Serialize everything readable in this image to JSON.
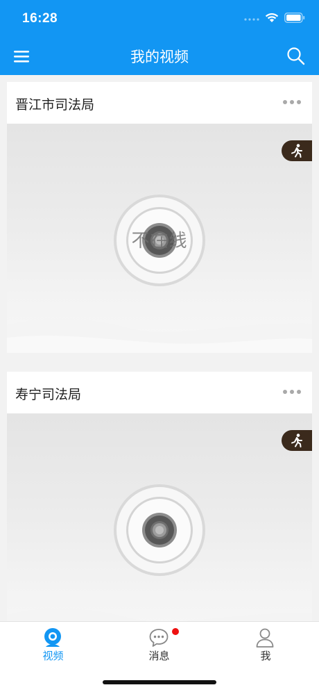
{
  "status_bar": {
    "time": "16:28"
  },
  "nav": {
    "title": "我的视频"
  },
  "cards": [
    {
      "title": "晋江市司法局",
      "status_overlay": "不在线"
    },
    {
      "title": "寿宁司法局"
    }
  ],
  "tabs": [
    {
      "label": "视频",
      "icon": "camera-icon",
      "active": true
    },
    {
      "label": "消息",
      "icon": "chat-bubble-icon",
      "active": false,
      "has_unread_dot": true
    },
    {
      "label": "我",
      "icon": "person-icon",
      "active": false
    }
  ],
  "colors": {
    "primary": "#1296f3",
    "badge": "#ee1111",
    "motion_badge": "#3b2a1c"
  }
}
